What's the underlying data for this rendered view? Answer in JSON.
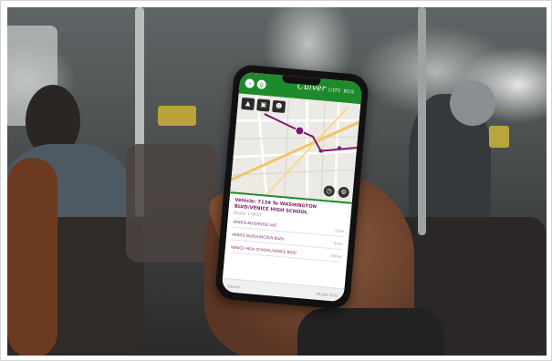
{
  "scene": "photo",
  "app": {
    "brand_main": "Culver",
    "brand_city": "CITY",
    "brand_bus": "BUS",
    "accent_color": "#1f8a2c",
    "route_color": "#7b1b6d",
    "header_icons": [
      "back-arrow-icon",
      "home-icon"
    ],
    "toolbar_icons": [
      "road-icon",
      "bus-icon",
      "person-icon"
    ],
    "map_controls": [
      "clock-icon",
      "settings-icon"
    ],
    "panel": {
      "title": "Vehicle: 7134 To WASHINGTON BLVD/VENICE HIGH SCHOOL",
      "subtitle": "Route: 1 WEST",
      "stops": [
        {
          "name": "VENICE BLVD/ROSE AVE",
          "time": "1min"
        },
        {
          "name": "VENICE BLVD/LINCOLN BLVD",
          "time": "5min"
        },
        {
          "name": "VENICE HIGH SCHOOL/VENICE BLVD",
          "time": "10min"
        }
      ]
    },
    "footer": {
      "left": "Search",
      "right": "18 JUN 2021"
    }
  }
}
